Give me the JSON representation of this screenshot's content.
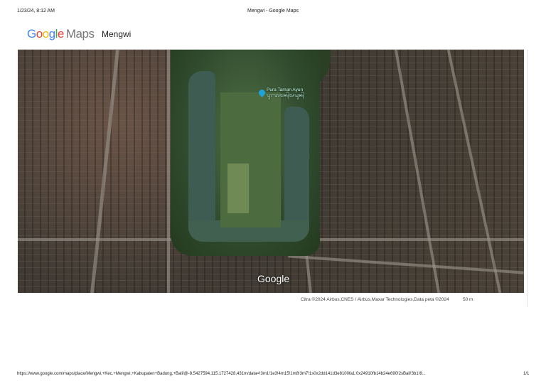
{
  "print_header": {
    "datetime": "1/23/24, 8:12 AM",
    "title": "Mengwi - Google Maps"
  },
  "logo": {
    "g1": "G",
    "g2": "o",
    "g3": "o",
    "g4": "g",
    "g5": "l",
    "g6": "e",
    "maps": "Maps"
  },
  "place_name": "Mengwi",
  "map": {
    "pin_label_line1": "Pura Taman Ayun",
    "pin_label_line2": "ᬧᬸᬭᬢᬫᬦ᭄ᬅᬬᬸᬦ᭄",
    "watermark": "Google",
    "attribution": "Citra ©2024 Airbus,CNES / Airbus,Maxar Technologies,Data peta ©2024",
    "scale": "50 m",
    "pin_color": "#1ea3d8"
  },
  "print_footer": {
    "url": "https://www.google.com/maps/place/Mengwi,+Kec.+Mengwi,+Kabupaten+Badung,+Bali/@-8.5427594,115.1727428,431m/data=!3m1!1e3!4m15!1m8!3m7!1s0x2dd141d3e8100fa1:0x24910fb14b24e690!2sBali!3b1!8...",
    "page": "1/1"
  }
}
